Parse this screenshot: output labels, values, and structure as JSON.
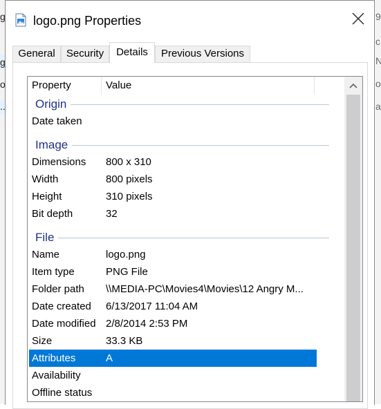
{
  "background_window": {
    "left_fragments": [
      "g",
      "g",
      "o",
      "..."
    ],
    "right_fragments": [
      "9",
      "c",
      "N",
      "o",
      "a"
    ]
  },
  "window": {
    "title": "logo.png Properties",
    "icon": "image-file-icon",
    "close_icon": "close-icon"
  },
  "tabs": [
    {
      "label": "General",
      "active": false
    },
    {
      "label": "Security",
      "active": false
    },
    {
      "label": "Details",
      "active": true
    },
    {
      "label": "Previous Versions",
      "active": false
    }
  ],
  "list": {
    "columns": [
      "Property",
      "Value"
    ],
    "groups": [
      {
        "name": "Origin",
        "rows": [
          {
            "property": "Date taken",
            "value": ""
          }
        ]
      },
      {
        "name": "Image",
        "rows": [
          {
            "property": "Dimensions",
            "value": "800 x 310"
          },
          {
            "property": "Width",
            "value": "800 pixels"
          },
          {
            "property": "Height",
            "value": "310 pixels"
          },
          {
            "property": "Bit depth",
            "value": "32"
          }
        ]
      },
      {
        "name": "File",
        "rows": [
          {
            "property": "Name",
            "value": "logo.png"
          },
          {
            "property": "Item type",
            "value": "PNG File"
          },
          {
            "property": "Folder path",
            "value": "\\\\MEDIA-PC\\Movies4\\Movies\\12 Angry M..."
          },
          {
            "property": "Date created",
            "value": "6/13/2017 11:04 AM"
          },
          {
            "property": "Date modified",
            "value": "2/8/2014 2:53 PM"
          },
          {
            "property": "Size",
            "value": "33.3 KB"
          },
          {
            "property": "Attributes",
            "value": "A",
            "selected": true
          },
          {
            "property": "Availability",
            "value": ""
          },
          {
            "property": "Offline status",
            "value": ""
          }
        ]
      }
    ]
  },
  "colors": {
    "selection": "#0078d7",
    "group_label": "#1e3287",
    "group_line": "#b9c6da"
  }
}
